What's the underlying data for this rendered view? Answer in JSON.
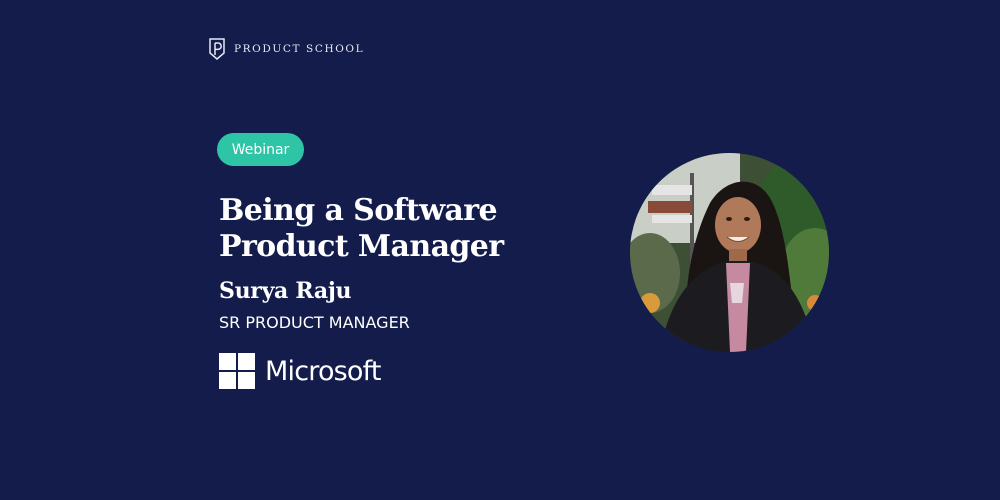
{
  "brand": {
    "name": "PRODUCT SCHOOL",
    "icon": "product-school-logo"
  },
  "event": {
    "badge": "Webinar",
    "title_line_1": "Being a Software",
    "title_line_2": "Product Manager"
  },
  "speaker": {
    "name": "Surya Raju",
    "role": "SR PRODUCT MANAGER",
    "company": "Microsoft",
    "company_icon": "microsoft-logo"
  },
  "colors": {
    "background": "#131c4b",
    "accent": "#2ec4a6",
    "text": "#ffffff"
  }
}
